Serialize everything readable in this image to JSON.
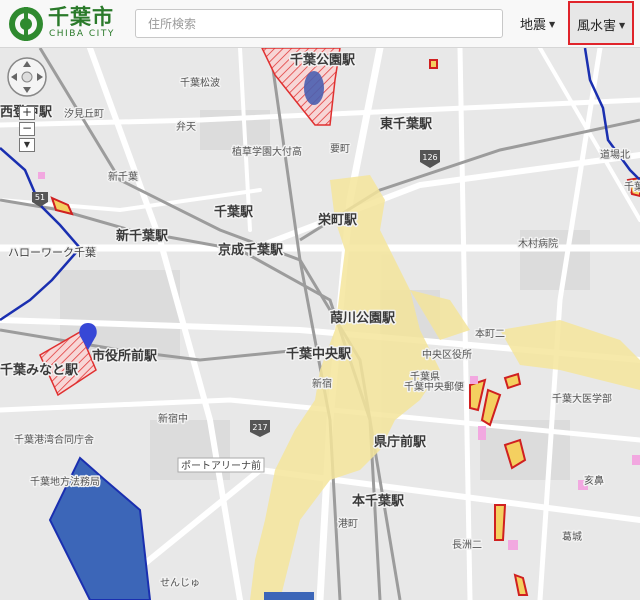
{
  "header": {
    "logo_ja": "千葉市",
    "logo_en": "CHIBA CITY",
    "search_placeholder": "住所検索",
    "menu_earthquake": "地震",
    "menu_flood": "風水害"
  },
  "map": {
    "zoom_in": "+",
    "zoom_out": "−",
    "stations": [
      "千葉公園駅",
      "西登戸駅",
      "東千葉駅",
      "千葉駅",
      "栄町駅",
      "新千葉駅",
      "京成千葉駅",
      "葭川公園駅",
      "千葉中央駅",
      "千葉みなと駅",
      "市役所前駅",
      "県庁前駅",
      "本千葉駅"
    ],
    "labels": {
      "chiba_matsunami": "千葉松波",
      "shiomidaoka": "汐見丘町",
      "benten": "弁天",
      "shokuso": "植草学園大付高",
      "kanamachi": "要町",
      "shinchiba": "新千葉",
      "kimura": "木村病院",
      "hellowork": "ハローワーク千葉",
      "chuo_ku": "中央区役所",
      "chiba_yubin": "千葉中央郵便",
      "honcho": "本町二",
      "shinjuku": "新宿",
      "shinjuku_c": "新宿中",
      "chiba_ko": "千葉港湾合同庁舎",
      "chiba_houmu": "千葉地方法務局",
      "port_arena": "ポートアリーナ前",
      "minato": "港町",
      "nagasu": "長洲二",
      "senju": "せんじゅ",
      "kuzuwa": "葛城",
      "chiba_ika": "千葉大医学部",
      "ikino": "亥鼻",
      "doyo": "道場北",
      "chiba_c": "千葉",
      "chiba_d": "千葉県"
    },
    "route_shields": [
      "126",
      "51",
      "217"
    ]
  }
}
